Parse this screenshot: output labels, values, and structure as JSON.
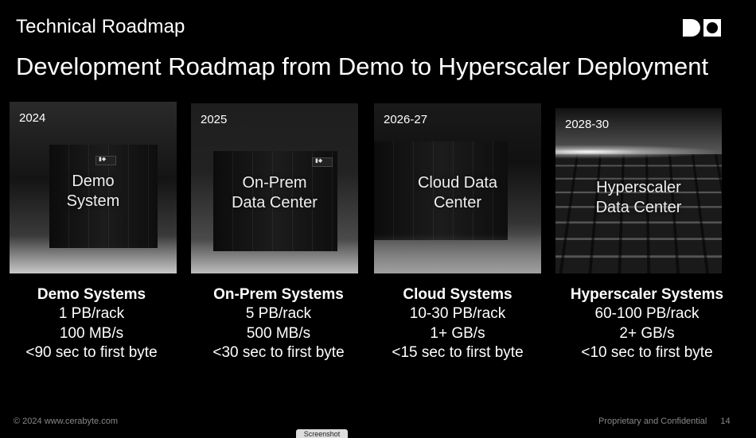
{
  "header": {
    "section_title": "Technical Roadmap",
    "headline": "Development Roadmap from Demo to Hyperscaler Deployment"
  },
  "cards": [
    {
      "year": "2024",
      "label_line1": "Demo",
      "label_line2": "System"
    },
    {
      "year": "2025",
      "label_line1": "On-Prem",
      "label_line2": "Data Center"
    },
    {
      "year": "2026-27",
      "label_line1": "Cloud Data",
      "label_line2": "Center"
    },
    {
      "year": "2028-30",
      "label_line1": "Hyperscaler",
      "label_line2": "Data Center"
    }
  ],
  "specs": [
    {
      "name": "Demo Systems",
      "capacity": "1 PB/rack",
      "throughput": "100 MB/s",
      "latency": "<90 sec to first byte"
    },
    {
      "name": "On-Prem Systems",
      "capacity": "5 PB/rack",
      "throughput": "500 MB/s",
      "latency": "<30 sec to first byte"
    },
    {
      "name": "Cloud Systems",
      "capacity": "10-30 PB/rack",
      "throughput": "1+ GB/s",
      "latency": "<15 sec to first byte"
    },
    {
      "name": "Hyperscaler Systems",
      "capacity": "60-100 PB/rack",
      "throughput": "2+ GB/s",
      "latency": "<10 sec to first byte"
    }
  ],
  "footer": {
    "copyright": "© 2024 www.cerabyte.com",
    "confidential": "Proprietary and Confidential",
    "page_number": "14"
  },
  "overlay": {
    "screenshot_tab": "Screenshot"
  }
}
